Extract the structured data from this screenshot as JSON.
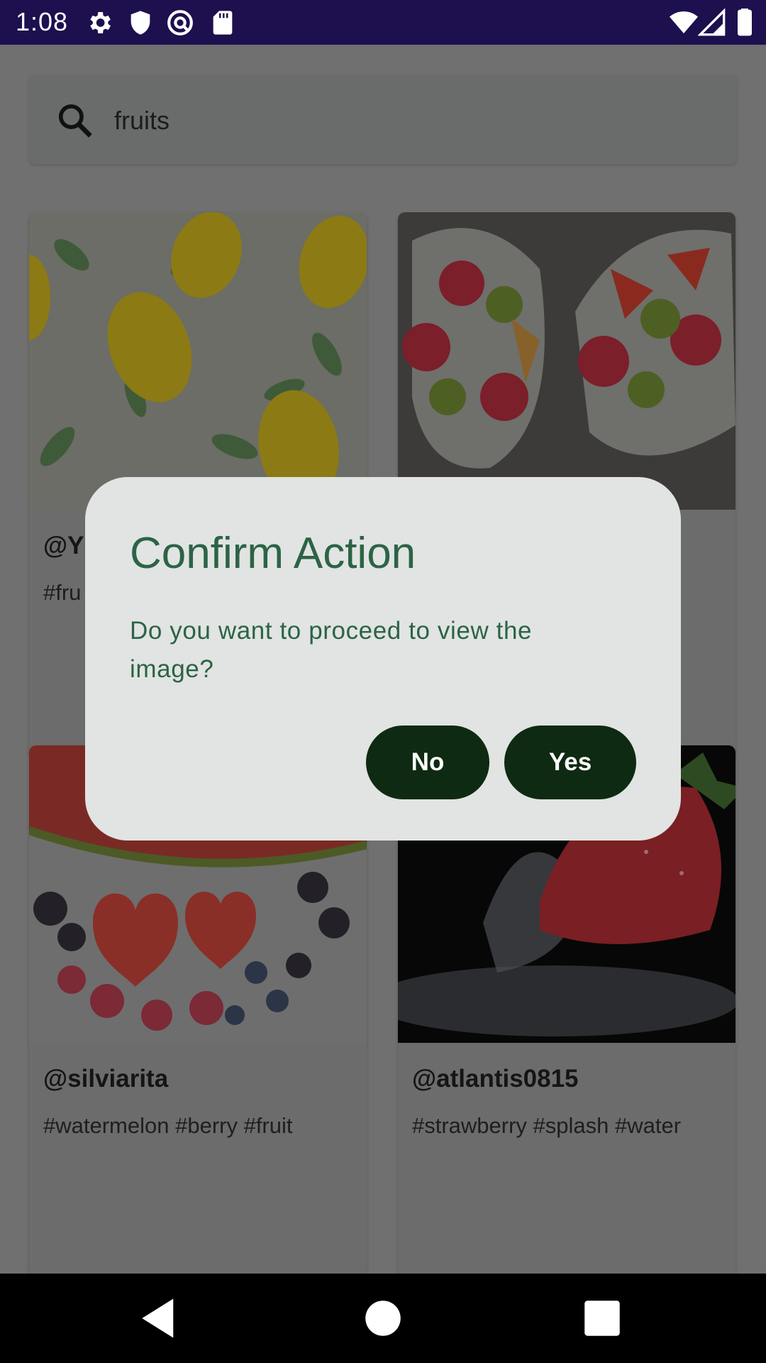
{
  "status_bar": {
    "time": "1:08",
    "left_icons": [
      "gear-icon",
      "shield-icon",
      "at-sign-icon",
      "sd-card-icon"
    ],
    "right_icons": [
      "wifi-icon",
      "cellular-signal-icon",
      "battery-icon"
    ]
  },
  "search": {
    "query": "fruits"
  },
  "cards": [
    {
      "user": "@Y",
      "tags": "#fru",
      "image": "lemons-pattern"
    },
    {
      "user": "",
      "tags": "",
      "image": "fruit-bowls"
    },
    {
      "user": "@silviarita",
      "tags": "#watermelon  #berry  #fruit",
      "image": "watermelon-berries"
    },
    {
      "user": "@atlantis0815",
      "tags": "#strawberry  #splash  #water",
      "image": "strawberry-splash"
    }
  ],
  "dialog": {
    "title": "Confirm Action",
    "message": "Do you want to proceed to view the image?",
    "no_label": "No",
    "yes_label": "Yes"
  },
  "nav": {
    "back_icon": "back-triangle-icon",
    "home_icon": "home-circle-icon",
    "recents_icon": "recents-square-icon"
  },
  "colors": {
    "status_bar": "#1e0f4f",
    "dialog_bg": "#e1e4e2",
    "dialog_text": "#2c6346",
    "button_bg": "#0f2a12"
  }
}
